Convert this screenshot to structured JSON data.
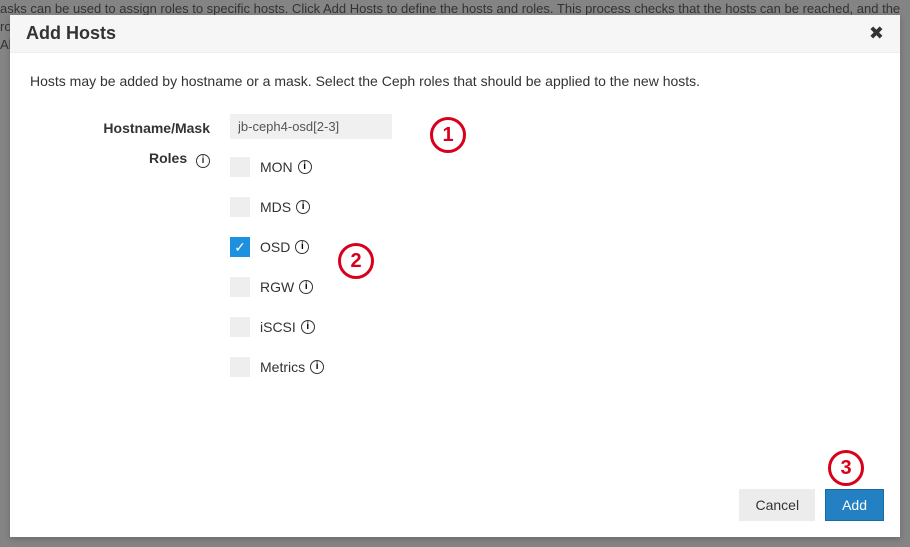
{
  "background": {
    "line1": "asks can be used to assign roles to specific hosts. Click  Add Hosts  to define the hosts and roles. This process checks that the hosts can be reached, and the roles r",
    "line2": "All"
  },
  "modal": {
    "title": "Add Hosts",
    "intro": "Hosts may be added by hostname or a mask. Select the Ceph roles that should be applied to the new hosts.",
    "hostname_label": "Hostname/Mask",
    "hostname_value": "jb-ceph4-osd[2-3]",
    "roles_label": "Roles",
    "roles": [
      {
        "name": "MON",
        "checked": false
      },
      {
        "name": "MDS",
        "checked": false
      },
      {
        "name": "OSD",
        "checked": true
      },
      {
        "name": "RGW",
        "checked": false
      },
      {
        "name": "iSCSI",
        "checked": false
      },
      {
        "name": "Metrics",
        "checked": false
      }
    ],
    "cancel_label": "Cancel",
    "add_label": "Add"
  },
  "callouts": {
    "c1": "1",
    "c2": "2",
    "c3": "3"
  }
}
